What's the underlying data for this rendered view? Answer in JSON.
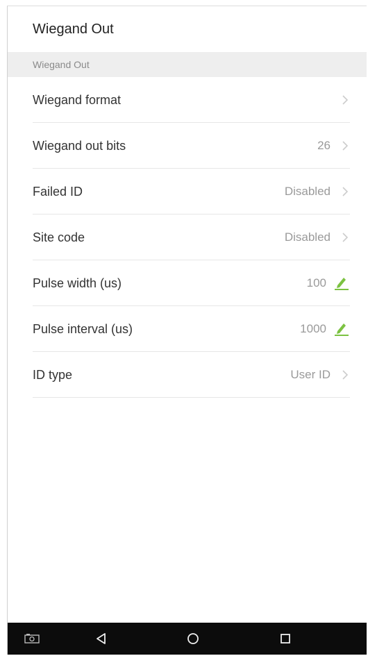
{
  "header": {
    "title": "Wiegand Out"
  },
  "section": {
    "title": "Wiegand Out"
  },
  "rows": [
    {
      "label": "Wiegand format",
      "value": "",
      "control": "chevron-right-icon"
    },
    {
      "label": "Wiegand out bits",
      "value": "26",
      "control": "chevron-right-icon"
    },
    {
      "label": "Failed ID",
      "value": "Disabled",
      "control": "chevron-right-icon"
    },
    {
      "label": "Site code",
      "value": "Disabled",
      "control": "chevron-right-icon"
    },
    {
      "label": "Pulse width (us)",
      "value": "100",
      "control": "pencil-edit-icon"
    },
    {
      "label": "Pulse interval (us)",
      "value": "1000",
      "control": "pencil-edit-icon"
    },
    {
      "label": "ID type",
      "value": "User ID",
      "control": "chevron-right-icon"
    }
  ],
  "navbar": {
    "icons": [
      "screenshot-icon",
      "back-icon",
      "home-icon",
      "recents-icon"
    ]
  },
  "colors": {
    "edit_accent": "#7cc242",
    "section_bg": "#eeeeee",
    "navbar_bg": "#0c0c0c"
  }
}
